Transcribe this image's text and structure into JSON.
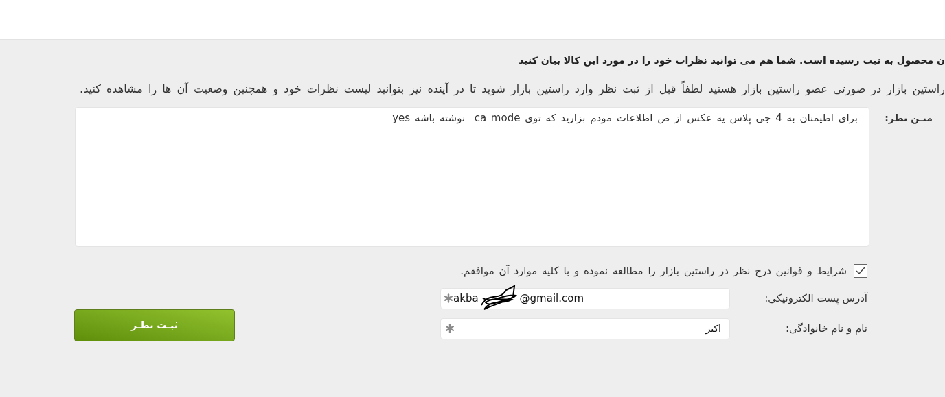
{
  "intro": {
    "heading": "ن محصول به ثبت رسیده است. شما هم می توانید نظرات خود را در مورد این کالا بیان کنید",
    "note": "راستین بازار در صورتی عضو راستین بازار هستید لطفاً قبل از ثبت نظر وارد راستین بازار شوید تا در آینده نیز بتوانید لیست نظرات خود و همچنین وضعیت آن ها را مشاهده کنید."
  },
  "comment": {
    "label": "متـن نظر:",
    "value": "برای اطیمنان به 4 جی پلاس یه عکس از ص اطلاعات مودم بزارید که توی ca mode  نوشته باشه yes"
  },
  "terms": {
    "label": "شرایط و قوانین درج نظر در راستین بازار را مطالعه نموده و با کلیه موارد آن موافقم.",
    "checked": true
  },
  "email": {
    "label": "آدرس پست الکترونیکی:",
    "value_start": "akba",
    "value_end": "@gmail.com",
    "required": true
  },
  "name": {
    "label": "نام و نام خانوادگی:",
    "value": "اکبر",
    "required": true
  },
  "submit": {
    "label": "ثبـت نظـر"
  }
}
